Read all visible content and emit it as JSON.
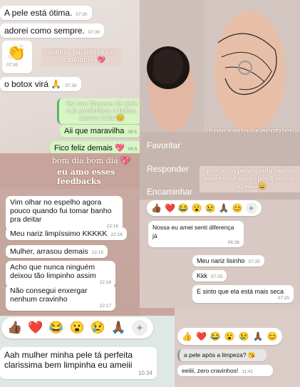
{
  "chat_top_left": {
    "messages": [
      {
        "text": "A pele está ótima.",
        "time": "07:30"
      },
      {
        "text": "adorei como sempre.",
        "time": "07:30"
      },
      {
        "emoji": "👏",
        "time": "07:30"
      },
      {
        "text": "o botox virá 🙏",
        "time": "07:30"
      }
    ],
    "caption": "minhas pacientes são as melhores💖",
    "quote": "fez sua limpeza de pele e já profetizou o botox, amooo haha😊",
    "replies": [
      {
        "text": "Aii que maravilha",
        "time": "08:5"
      },
      {
        "text": "Fico feliz demais 💖",
        "time": "08:5"
      }
    ]
  },
  "story_top_right": {
    "caption": "hoje cedo já acordei com feedback, amooo",
    "menu": [
      "Favoritar",
      "Responder",
      "Encaminhar"
    ],
    "subcaption": "protocolo para queda capilar, esse resultados após 4 sessões apenas😄"
  },
  "banner": {
    "line1": "bom dia bom dia 💖",
    "line2": "eu amo esses feedbacks"
  },
  "chat_mid_left": [
    {
      "text": "Vim olhar no espelho agora pouco quando fui tomar banho pra deitar",
      "time": "22:16"
    },
    {
      "text": "Meu nariz limpíssimo KKKKK",
      "time": "22:16"
    },
    {
      "text": "Mulher, arrasou demais",
      "time": "22:16"
    },
    {
      "text": "Acho que nunca ninguém deixou tão limpinho assim",
      "time": "22:16"
    },
    {
      "text": "Não consegui enxergar nenhum cravinho",
      "time": "22:17"
    }
  ],
  "chat_mid_right": {
    "reactions": [
      "👍🏾",
      "❤️",
      "😂",
      "😮",
      "😢",
      "🙏🏾",
      "😊"
    ],
    "first": {
      "text": "Nossa eu amei senti diferença já",
      "time": "06:36"
    },
    "messages": [
      {
        "text": "Meu nariz lisinho",
        "time": "07:25"
      },
      {
        "text": "Kkk",
        "time": "07:25"
      },
      {
        "text": "E sinto que ela está mais seca",
        "time": "07:25"
      }
    ]
  },
  "chat_bottom_left": {
    "reactions": [
      "👍🏾",
      "❤️",
      "😂",
      "😮",
      "😢",
      "🙏🏾"
    ],
    "text": "Aah mulher minha pele tá perfeita clarissima bem limpinha eu ameiii",
    "time": "10:34"
  },
  "chat_bottom_right": {
    "reactions": [
      "👍",
      "❤️",
      "😂",
      "😮",
      "😢",
      "🙏🏾",
      "😊"
    ],
    "question": "a pele após a limpeza? 😘",
    "answer": "eeiiii, zero cravinhos!",
    "time": "11:41"
  }
}
